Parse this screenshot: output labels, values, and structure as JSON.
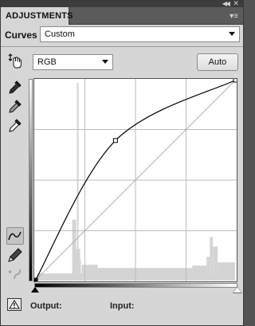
{
  "panel": {
    "tab_title": "ADJUSTMENTS",
    "adjustment_name": "Curves",
    "preset_value": "Custom"
  },
  "channel": {
    "value": "RGB"
  },
  "buttons": {
    "auto": "Auto"
  },
  "readouts": {
    "output_label": "Output:",
    "input_label": "Input:"
  },
  "curve": {
    "points": [
      [
        0,
        0
      ],
      [
        102,
        178
      ],
      [
        255,
        255
      ]
    ],
    "shape": "strong brightening curve"
  },
  "icons": {
    "collapse": "double-chevron-left-icon",
    "close": "close-icon",
    "panel_menu": "panel-menu-icon",
    "target_adjust": "hand-target-icon",
    "black_point": "eyedropper-black-icon",
    "gray_point": "eyedropper-gray-icon",
    "white_point": "eyedropper-white-icon",
    "curve_tool": "curve-tool-icon",
    "pencil_tool": "pencil-icon",
    "smooth_tool": "smooth-curve-icon",
    "clipping": "clipping-warning-icon"
  },
  "colors": {
    "panel_bg": "#d6d6d6",
    "tabbar_bg": "#5b5b5b",
    "graph_bg": "#ffffff",
    "curve": "#000000",
    "histogram": "#cfcfcf"
  }
}
